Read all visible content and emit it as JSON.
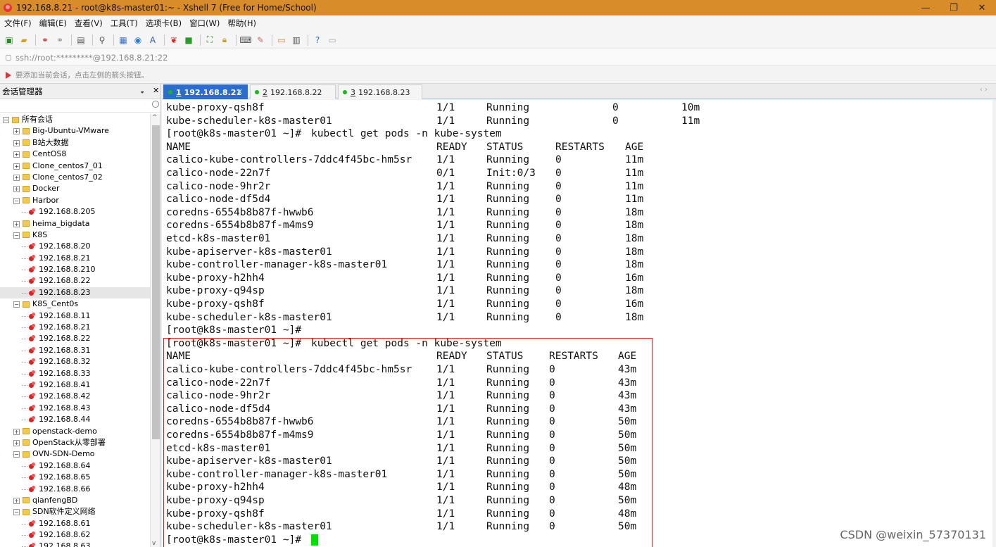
{
  "window": {
    "title": "192.168.8.21 - root@k8s-master01:~ - Xshell 7 (Free for Home/School)",
    "minimize": "—",
    "maximize": "❐",
    "close": "✕"
  },
  "menu": [
    "文件(F)",
    "编辑(E)",
    "查看(V)",
    "工具(T)",
    "选项卡(B)",
    "窗口(W)",
    "帮助(H)"
  ],
  "address": "ssh://root:*********@192.168.8.21:22",
  "hint": "要添加当前会话，点击左侧的箭头按钮。",
  "sidebar": {
    "title": "会话管理器",
    "pin": "ᵩ",
    "close": "✕",
    "scroll_up": "^",
    "scroll_down": "v",
    "tree": [
      {
        "label": "所有会话",
        "type": "root",
        "level": 0,
        "exp": "−"
      },
      {
        "label": "Big-Ubuntu-VMware",
        "type": "folder",
        "level": 1,
        "exp": "+"
      },
      {
        "label": "B站大数据",
        "type": "folder",
        "level": 1,
        "exp": "+"
      },
      {
        "label": "CentOS8",
        "type": "folder",
        "level": 1,
        "exp": "+"
      },
      {
        "label": "Clone_centos7_01",
        "type": "folder",
        "level": 1,
        "exp": "+"
      },
      {
        "label": "Clone_centos7_02",
        "type": "folder",
        "level": 1,
        "exp": "+"
      },
      {
        "label": "Docker",
        "type": "folder",
        "level": 1,
        "exp": "+"
      },
      {
        "label": "Harbor",
        "type": "folder",
        "level": 1,
        "exp": "−"
      },
      {
        "label": "192.168.8.205",
        "type": "session",
        "level": 2
      },
      {
        "label": "heima_bigdata",
        "type": "folder",
        "level": 1,
        "exp": "+"
      },
      {
        "label": "K8S",
        "type": "folder",
        "level": 1,
        "exp": "−"
      },
      {
        "label": "192.168.8.20",
        "type": "session",
        "level": 2
      },
      {
        "label": "192.168.8.21",
        "type": "session",
        "level": 2
      },
      {
        "label": "192.168.8.210",
        "type": "session",
        "level": 2
      },
      {
        "label": "192.168.8.22",
        "type": "session",
        "level": 2
      },
      {
        "label": "192.168.8.23",
        "type": "session",
        "level": 2,
        "selected": true
      },
      {
        "label": "K8S_Cent0s",
        "type": "folder",
        "level": 1,
        "exp": "−"
      },
      {
        "label": "192.168.8.11",
        "type": "session",
        "level": 2
      },
      {
        "label": "192.168.8.21",
        "type": "session",
        "level": 2
      },
      {
        "label": "192.168.8.22",
        "type": "session",
        "level": 2
      },
      {
        "label": "192.168.8.31",
        "type": "session",
        "level": 2
      },
      {
        "label": "192.168.8.32",
        "type": "session",
        "level": 2
      },
      {
        "label": "192.168.8.33",
        "type": "session",
        "level": 2
      },
      {
        "label": "192.168.8.41",
        "type": "session",
        "level": 2
      },
      {
        "label": "192.168.8.42",
        "type": "session",
        "level": 2
      },
      {
        "label": "192.168.8.43",
        "type": "session",
        "level": 2
      },
      {
        "label": "192.168.8.44",
        "type": "session",
        "level": 2
      },
      {
        "label": "openstack-demo",
        "type": "folder",
        "level": 1,
        "exp": "+"
      },
      {
        "label": "OpenStack从零部署",
        "type": "folder",
        "level": 1,
        "exp": "+"
      },
      {
        "label": "OVN-SDN-Demo",
        "type": "folder",
        "level": 1,
        "exp": "−"
      },
      {
        "label": "192.168.8.64",
        "type": "session",
        "level": 2
      },
      {
        "label": "192.168.8.65",
        "type": "session",
        "level": 2
      },
      {
        "label": "192.168.8.66",
        "type": "session",
        "level": 2
      },
      {
        "label": "qianfengBD",
        "type": "folder",
        "level": 1,
        "exp": "+"
      },
      {
        "label": "SDN软件定义网络",
        "type": "folder",
        "level": 1,
        "exp": "−"
      },
      {
        "label": "192.168.8.61",
        "type": "session",
        "level": 2
      },
      {
        "label": "192.168.8.62",
        "type": "session",
        "level": 2
      },
      {
        "label": "192.168.8.63",
        "type": "session",
        "level": 2
      }
    ]
  },
  "tabs": [
    {
      "num": "1",
      "label": "192.168.8.21",
      "active": true
    },
    {
      "num": "2",
      "label": "192.168.8.22",
      "active": false
    },
    {
      "num": "3",
      "label": "192.168.8.23",
      "active": false
    }
  ],
  "tab_nav": "‹ ›",
  "terminal": {
    "prompt": "[root@k8s-master01 ~]#",
    "command": "kubectl get pods -n kube-system",
    "top_rows": [
      [
        "kube-proxy-qsh8f",
        "1/1",
        "Running",
        "0",
        "10m"
      ],
      [
        "kube-scheduler-k8s-master01",
        "1/1",
        "Running",
        "0",
        "11m"
      ]
    ],
    "header": [
      "NAME",
      "READY",
      "STATUS",
      "RESTARTS",
      "AGE"
    ],
    "block1": [
      [
        "calico-kube-controllers-7ddc4f45bc-hm5sr",
        "1/1",
        "Running",
        "0",
        "11m"
      ],
      [
        "calico-node-22n7f",
        "0/1",
        "Init:0/3",
        "0",
        "11m"
      ],
      [
        "calico-node-9hr2r",
        "1/1",
        "Running",
        "0",
        "11m"
      ],
      [
        "calico-node-df5d4",
        "1/1",
        "Running",
        "0",
        "11m"
      ],
      [
        "coredns-6554b8b87f-hwwb6",
        "1/1",
        "Running",
        "0",
        "18m"
      ],
      [
        "coredns-6554b8b87f-m4ms9",
        "1/1",
        "Running",
        "0",
        "18m"
      ],
      [
        "etcd-k8s-master01",
        "1/1",
        "Running",
        "0",
        "18m"
      ],
      [
        "kube-apiserver-k8s-master01",
        "1/1",
        "Running",
        "0",
        "18m"
      ],
      [
        "kube-controller-manager-k8s-master01",
        "1/1",
        "Running",
        "0",
        "18m"
      ],
      [
        "kube-proxy-h2hh4",
        "1/1",
        "Running",
        "0",
        "16m"
      ],
      [
        "kube-proxy-q94sp",
        "1/1",
        "Running",
        "0",
        "18m"
      ],
      [
        "kube-proxy-qsh8f",
        "1/1",
        "Running",
        "0",
        "16m"
      ],
      [
        "kube-scheduler-k8s-master01",
        "1/1",
        "Running",
        "0",
        "18m"
      ]
    ],
    "block2": [
      [
        "calico-kube-controllers-7ddc4f45bc-hm5sr",
        "1/1",
        "Running",
        "0",
        "43m"
      ],
      [
        "calico-node-22n7f",
        "1/1",
        "Running",
        "0",
        "43m"
      ],
      [
        "calico-node-9hr2r",
        "1/1",
        "Running",
        "0",
        "43m"
      ],
      [
        "calico-node-df5d4",
        "1/1",
        "Running",
        "0",
        "43m"
      ],
      [
        "coredns-6554b8b87f-hwwb6",
        "1/1",
        "Running",
        "0",
        "50m"
      ],
      [
        "coredns-6554b8b87f-m4ms9",
        "1/1",
        "Running",
        "0",
        "50m"
      ],
      [
        "etcd-k8s-master01",
        "1/1",
        "Running",
        "0",
        "50m"
      ],
      [
        "kube-apiserver-k8s-master01",
        "1/1",
        "Running",
        "0",
        "50m"
      ],
      [
        "kube-controller-manager-k8s-master01",
        "1/1",
        "Running",
        "0",
        "50m"
      ],
      [
        "kube-proxy-h2hh4",
        "1/1",
        "Running",
        "0",
        "48m"
      ],
      [
        "kube-proxy-q94sp",
        "1/1",
        "Running",
        "0",
        "50m"
      ],
      [
        "kube-proxy-qsh8f",
        "1/1",
        "Running",
        "0",
        "48m"
      ],
      [
        "kube-scheduler-k8s-master01",
        "1/1",
        "Running",
        "0",
        "50m"
      ]
    ]
  },
  "watermark": "CSDN @weixin_57370131",
  "colors": {
    "title_bar": "#d98c2a",
    "active_tab": "#2b6cd0",
    "highlight_box": "#e02020",
    "cursor": "#00e000"
  }
}
